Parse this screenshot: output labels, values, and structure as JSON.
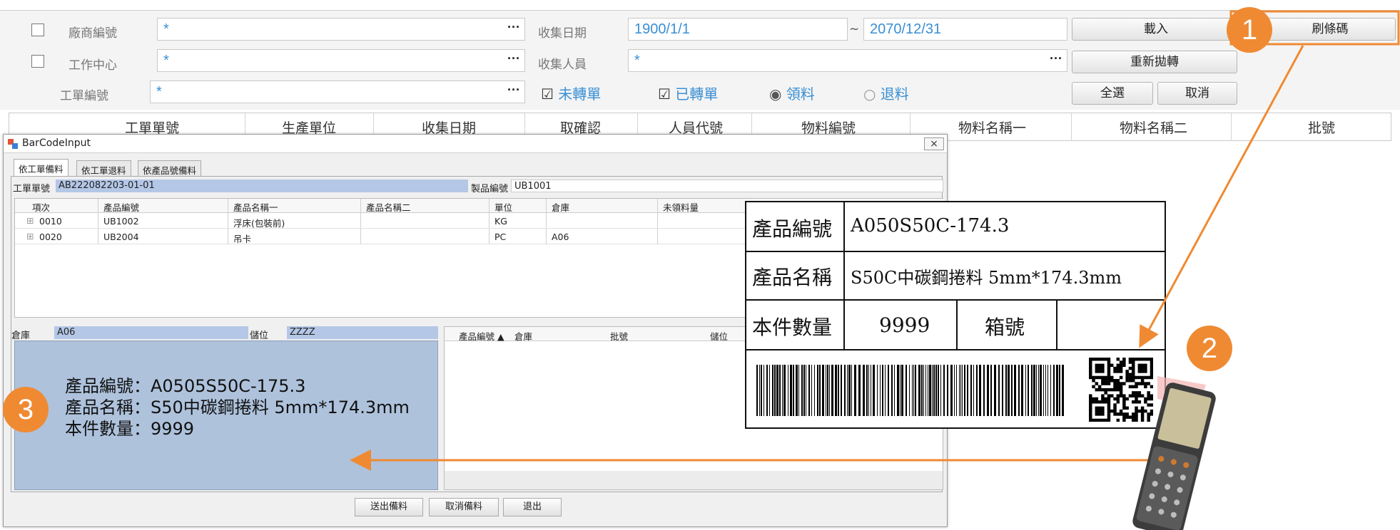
{
  "filter": {
    "vendor_no_label": "廠商編號",
    "vendor_no_value": "*",
    "work_center_label": "工作中心",
    "work_center_value": "*",
    "work_order_label": "工單編號",
    "work_order_value": "*",
    "collect_date_label": "收集日期",
    "date_from": "1900/1/1",
    "date_tilde": "~",
    "date_to": "2070/12/31",
    "collector_label": "收集人員",
    "collector_value": "*",
    "not_transferred": "未轉單",
    "transferred": "已轉單",
    "pick": "領料",
    "return": "退料",
    "dots": "···"
  },
  "buttons": {
    "load": "載入",
    "scan": "刷條碼",
    "retransfer": "重新拋轉",
    "select_all": "全選",
    "cancel": "取消"
  },
  "grid_headers": [
    "工單單號",
    "生產單位",
    "收集日期",
    "取確認",
    "人員代號",
    "物料編號",
    "物料名稱一",
    "物料名稱二",
    "批號"
  ],
  "dialog": {
    "title": "BarCodeInput",
    "close": "×",
    "tabs": [
      "依工單備料",
      "依工單退料",
      "依產品號備料"
    ],
    "wo_label": "工單單號",
    "wo_value": "AB222082203-01-01",
    "product_label": "製品編號",
    "product_value": "UB1001",
    "table_headers": [
      "項次",
      "產品編號",
      "產品名稱一",
      "產品名稱二",
      "單位",
      "倉庫",
      "未領料量"
    ],
    "rows": [
      {
        "item": "0010",
        "code": "UB1002",
        "name1": "浮床(包裝前)",
        "name2": "",
        "unit": "KG",
        "wh": "",
        "qty": ""
      },
      {
        "item": "0020",
        "code": "UB2004",
        "name1": "吊卡",
        "name2": "",
        "unit": "PC",
        "wh": "A06",
        "qty": ""
      }
    ],
    "warehouse_label": "倉庫",
    "warehouse_value": "A06",
    "location_label": "儲位",
    "location_value": "ZZZZ",
    "right_headers": [
      "產品編號 ▲",
      "倉庫",
      "批號",
      "儲位"
    ],
    "scan_info": [
      "產品編號：A0505S50C-175.3",
      "產品名稱：S50中碳鋼捲料 5mm*174.3mm",
      "本件數量：9999"
    ],
    "btn_send": "送出備料",
    "btn_cancel": "取消備料",
    "btn_exit": "退出"
  },
  "card": {
    "code_label": "產品編號",
    "code_value": "A050S50C-174.3",
    "name_label": "產品名稱",
    "name_value": "S50C中碳鋼捲料 5mm*174.3mm",
    "qty_label": "本件數量",
    "qty_value": "9999",
    "box_label": "箱號"
  },
  "steps": [
    "1",
    "2",
    "3"
  ],
  "colors": {
    "accent": "#ef8a33",
    "input_text": "#3a8fd4",
    "selection": "#b4c7e7"
  }
}
